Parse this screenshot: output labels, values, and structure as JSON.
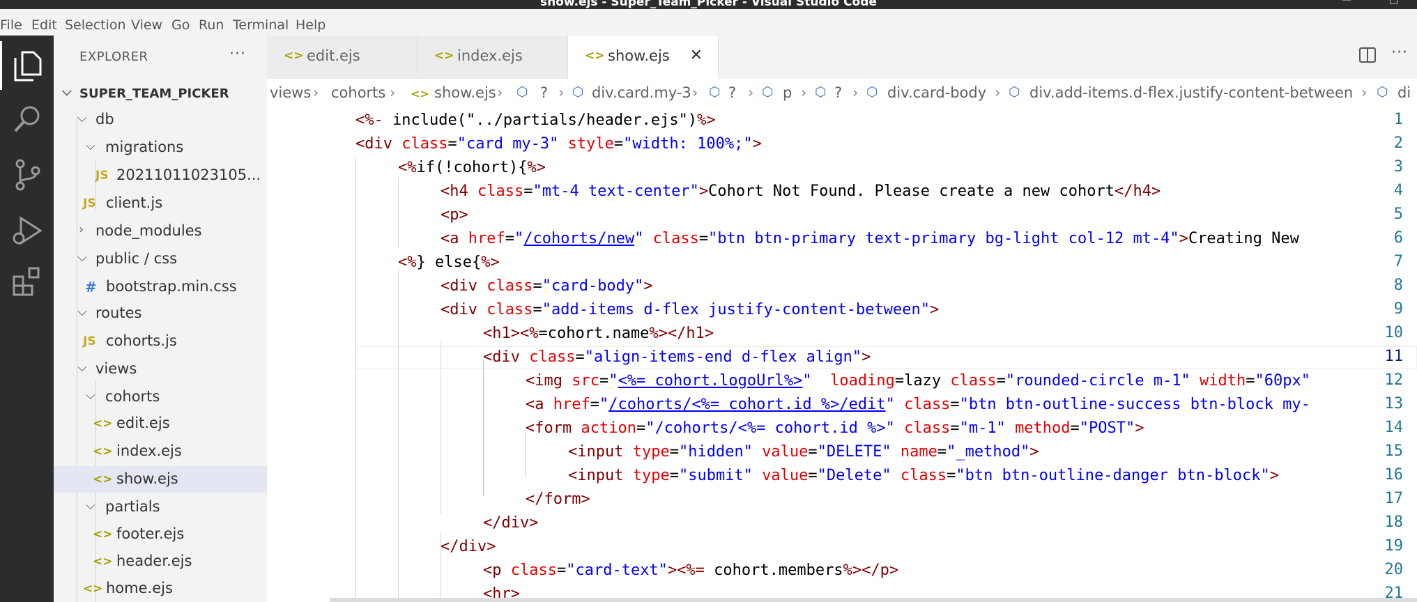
{
  "window": {
    "title": "show.ejs - Super_Team_Picker - Visual Studio Code"
  },
  "menu": [
    "File",
    "Edit",
    "Selection",
    "View",
    "Go",
    "Run",
    "Terminal",
    "Help"
  ],
  "activity_bar": [
    "explorer-icon",
    "search-icon",
    "source-control-icon",
    "run-debug-icon",
    "extensions-icon"
  ],
  "sidebar": {
    "header": "EXPLORER",
    "more": "···",
    "tree": [
      {
        "label": "SUPER_TEAM_PICKER",
        "kind": "root",
        "expanded": true
      },
      {
        "label": "db",
        "kind": "folder",
        "expanded": true
      },
      {
        "label": "migrations",
        "kind": "folder",
        "expanded": true
      },
      {
        "label": "20211011023105...",
        "kind": "js"
      },
      {
        "label": "client.js",
        "kind": "js"
      },
      {
        "label": "node_modules",
        "kind": "folder",
        "expanded": false
      },
      {
        "label": "public / css",
        "kind": "folder",
        "expanded": true
      },
      {
        "label": "bootstrap.min.css",
        "kind": "css"
      },
      {
        "label": "routes",
        "kind": "folder",
        "expanded": true
      },
      {
        "label": "cohorts.js",
        "kind": "js"
      },
      {
        "label": "views",
        "kind": "folder",
        "expanded": true
      },
      {
        "label": "cohorts",
        "kind": "folder",
        "expanded": true
      },
      {
        "label": "edit.ejs",
        "kind": "ejs"
      },
      {
        "label": "index.ejs",
        "kind": "ejs"
      },
      {
        "label": "show.ejs",
        "kind": "ejs",
        "selected": true
      },
      {
        "label": "partials",
        "kind": "folder",
        "expanded": true
      },
      {
        "label": "footer.ejs",
        "kind": "ejs"
      },
      {
        "label": "header.ejs",
        "kind": "ejs"
      },
      {
        "label": "home.ejs",
        "kind": "ejs"
      }
    ]
  },
  "tabs": [
    {
      "label": "edit.ejs",
      "active": false
    },
    {
      "label": "index.ejs",
      "active": false
    },
    {
      "label": "show.ejs",
      "active": true,
      "close": "✕"
    }
  ],
  "breadcrumbs": [
    "views",
    "cohorts",
    "show.ejs",
    "?",
    "div.card.my-3",
    "?",
    "p",
    "?",
    "div.card-body",
    "div.add-items.d-flex.justify-content-between",
    "di"
  ],
  "editor": {
    "current_line": 11,
    "line_numbers": [
      "1",
      "2",
      "3",
      "4",
      "5",
      "6",
      "7",
      "8",
      "9",
      "10",
      "11",
      "12",
      "13",
      "14",
      "15",
      "16",
      "17",
      "18",
      "19",
      "20",
      "21"
    ]
  }
}
